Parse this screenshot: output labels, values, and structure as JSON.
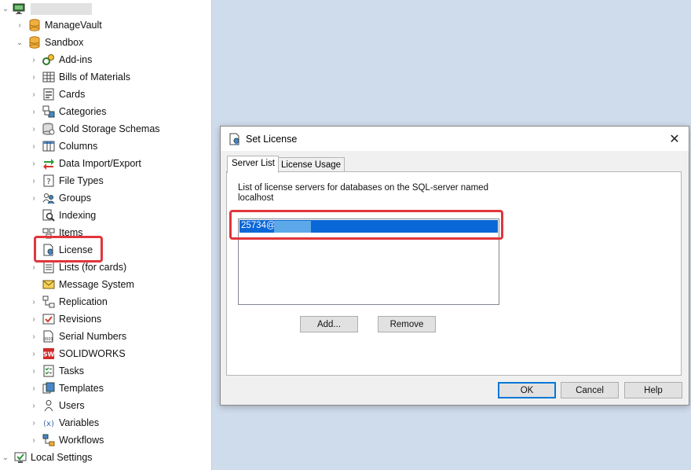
{
  "tree": {
    "root": {
      "icon": "computer-icon",
      "label_redacted": true
    },
    "vaults": [
      {
        "label": "ManageVault",
        "icon": "database-icon"
      },
      {
        "label": "Sandbox",
        "icon": "database-icon"
      }
    ],
    "items": [
      {
        "label": "Add-ins",
        "icon": "addins-icon",
        "expandable": true
      },
      {
        "label": "Bills of Materials",
        "icon": "table-icon",
        "expandable": true
      },
      {
        "label": "Cards",
        "icon": "card-icon",
        "expandable": true
      },
      {
        "label": "Categories",
        "icon": "categories-icon",
        "expandable": true
      },
      {
        "label": "Cold Storage Schemas",
        "icon": "cold-storage-icon",
        "expandable": true
      },
      {
        "label": "Columns",
        "icon": "columns-icon",
        "expandable": true
      },
      {
        "label": "Data Import/Export",
        "icon": "import-export-icon",
        "expandable": true
      },
      {
        "label": "File Types",
        "icon": "file-types-icon",
        "expandable": true
      },
      {
        "label": "Groups",
        "icon": "groups-icon",
        "expandable": true
      },
      {
        "label": "Indexing",
        "icon": "indexing-icon",
        "expandable": false
      },
      {
        "label": "Items",
        "icon": "items-icon",
        "expandable": false
      },
      {
        "label": "License",
        "icon": "license-icon",
        "expandable": false
      },
      {
        "label": "Lists (for cards)",
        "icon": "lists-icon",
        "expandable": true
      },
      {
        "label": "Message System",
        "icon": "message-icon",
        "expandable": false
      },
      {
        "label": "Replication",
        "icon": "replication-icon",
        "expandable": true
      },
      {
        "label": "Revisions",
        "icon": "revisions-icon",
        "expandable": true
      },
      {
        "label": "Serial Numbers",
        "icon": "serial-numbers-icon",
        "expandable": true
      },
      {
        "label": "SOLIDWORKS",
        "icon": "solidworks-icon",
        "expandable": true
      },
      {
        "label": "Tasks",
        "icon": "tasks-icon",
        "expandable": true
      },
      {
        "label": "Templates",
        "icon": "templates-icon",
        "expandable": true
      },
      {
        "label": "Users",
        "icon": "users-icon",
        "expandable": true
      },
      {
        "label": "Variables",
        "icon": "variables-icon",
        "expandable": true
      },
      {
        "label": "Workflows",
        "icon": "workflows-icon",
        "expandable": true
      }
    ],
    "local_settings": {
      "label": "Local Settings",
      "icon": "local-settings-icon"
    }
  },
  "dialog": {
    "title": "Set License",
    "close_glyph": "✕",
    "tabs": [
      {
        "label": "Server List",
        "active": true
      },
      {
        "label": "License Usage",
        "active": false
      }
    ],
    "description": "List of license servers for databases on the SQL-server named localhost",
    "servers": [
      "25734@"
    ],
    "buttons": {
      "add": "Add...",
      "remove": "Remove",
      "ok": "OK",
      "cancel": "Cancel",
      "help": "Help"
    }
  },
  "colors": {
    "highlight": "#e0363c",
    "selection": "#0a67d8",
    "background": "#cfdcec"
  }
}
